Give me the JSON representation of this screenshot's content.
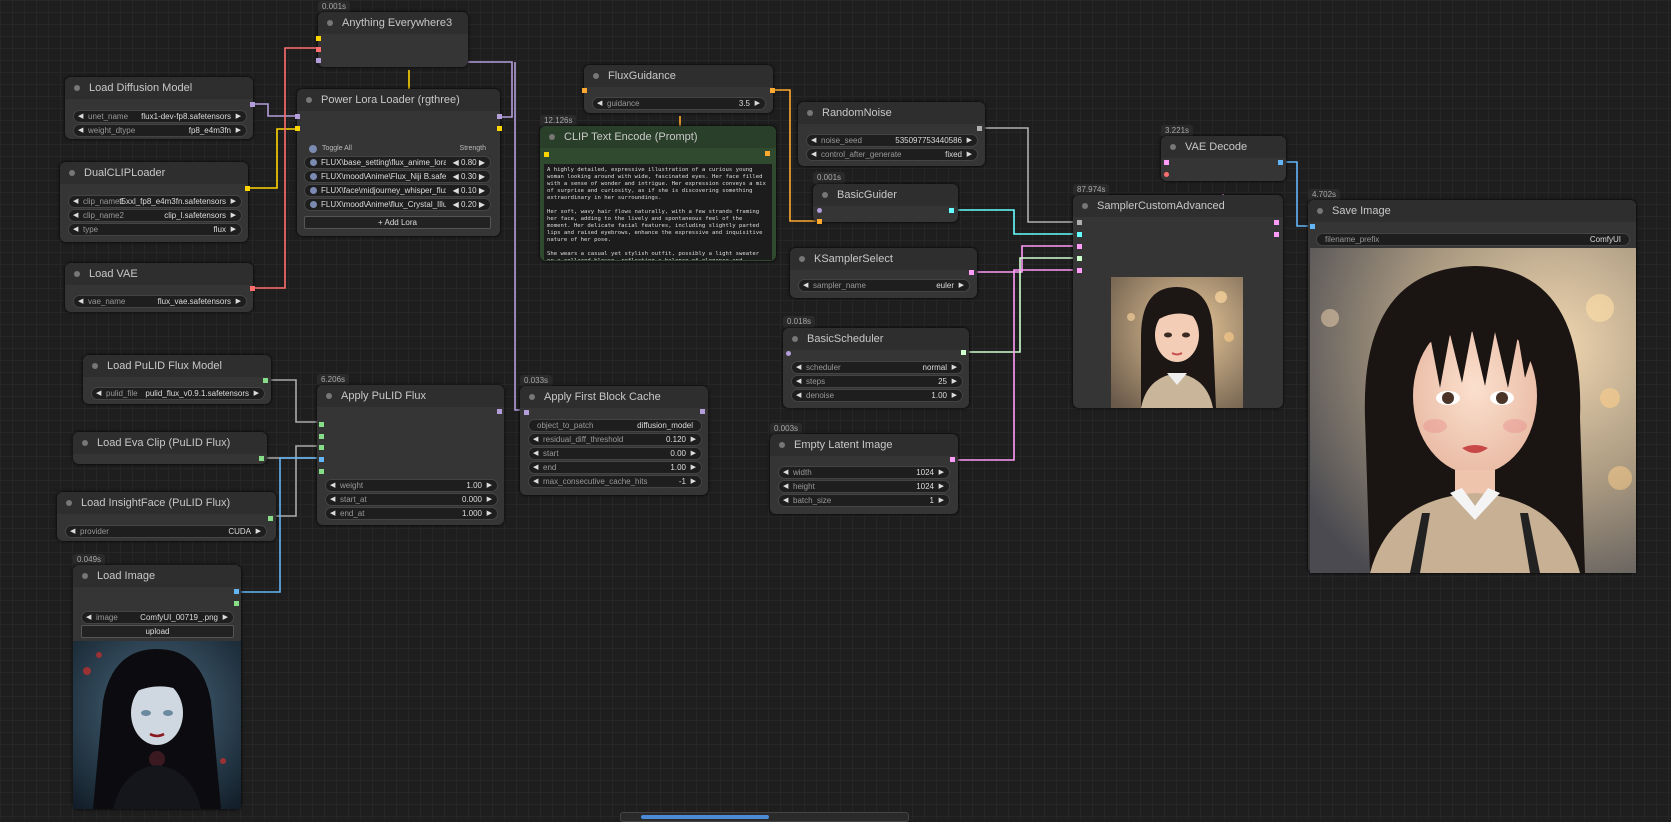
{
  "nodes": {
    "anything_everywhere": {
      "title": "Anything Everywhere3",
      "timing": "0.001s"
    },
    "load_diffusion": {
      "title": "Load Diffusion Model",
      "unet_name_label": "unet_name",
      "unet_name": "flux1-dev-fp8.safetensors",
      "weight_dtype_label": "weight_dtype",
      "weight_dtype": "fp8_e4m3fn"
    },
    "dual_clip": {
      "title": "DualCLIPLoader",
      "clip1_label": "clip_name1",
      "clip1": "t5xxl_fp8_e4m3fn.safetensors",
      "clip2_label": "clip_name2",
      "clip2": "clip_l.safetensors",
      "type_label": "type",
      "type": "flux"
    },
    "load_vae": {
      "title": "Load VAE",
      "vae_label": "vae_name",
      "vae": "flux_vae.safetensors"
    },
    "power_lora": {
      "title": "Power Lora Loader (rgthree)",
      "toggle_all": "Toggle All",
      "strength": "Strength",
      "loras": [
        {
          "name": "FLUX\\base_setting\\flux_anime_lora.sa...",
          "strength": "0.80"
        },
        {
          "name": "FLUX\\mood\\Anime\\Flux_Niji B.safeten...",
          "strength": "0.30"
        },
        {
          "name": "FLUX\\face\\midjourney_whisper_flux_lo...",
          "strength": "0.10"
        },
        {
          "name": "FLUX\\mood\\Anime\\flux_Crystal_Illustr...",
          "strength": "0.20"
        }
      ],
      "add_lora": "+ Add Lora"
    },
    "flux_guidance": {
      "title": "FluxGuidance",
      "guidance_label": "guidance",
      "guidance": "3.5"
    },
    "clip_text": {
      "title": "CLIP Text Encode (Prompt)",
      "timing": "12.126s",
      "prompt": [
        "A highly detailed, expressive illustration of a curious young woman looking around with wide, fascinated eyes. Her face filled with a sense of wonder and intrigue. Her expression conveys a mix of surprise and curiosity, as if she is discovering something extraordinary in her surroundings.",
        "Her soft, wavy hair flows naturally, with a few strands framing her face, adding to the lively and spontaneous feel of the moment. Her delicate facial features, including slightly parted lips and raised eyebrows, enhance the expressive and inquisitive nature of her pose.",
        "She wears a casual yet stylish outfit, possibly a light sweater or a collared blouse, reflecting a balance of elegance and everyday charm. The lighting is soft and warm, casting gentle highlights on her smooth skin"
      ]
    },
    "random_noise": {
      "title": "RandomNoise",
      "seed_label": "noise_seed",
      "seed": "535097753440586",
      "control_label": "control_after_generate",
      "control": "fixed"
    },
    "basic_guider": {
      "title": "BasicGuider",
      "timing": "0.001s"
    },
    "ksampler_select": {
      "title": "KSamplerSelect",
      "sampler_label": "sampler_name",
      "sampler": "euler"
    },
    "basic_scheduler": {
      "title": "BasicScheduler",
      "timing": "0.018s",
      "scheduler_label": "scheduler",
      "scheduler": "normal",
      "steps_label": "steps",
      "steps": "25",
      "denoise_label": "denoise",
      "denoise": "1.00"
    },
    "empty_latent": {
      "title": "Empty Latent Image",
      "timing": "0.003s",
      "width_label": "width",
      "width": "1024",
      "height_label": "height",
      "height": "1024",
      "batch_label": "batch_size",
      "batch": "1"
    },
    "vae_decode": {
      "title": "VAE Decode",
      "timing": "3.221s"
    },
    "sampler_custom": {
      "title": "SamplerCustomAdvanced",
      "timing": "87.974s"
    },
    "save_image": {
      "title": "Save Image",
      "timing": "4.702s",
      "prefix_label": "filename_prefix",
      "prefix": "ComfyUI"
    },
    "load_pulid": {
      "title": "Load PuLID Flux Model",
      "file_label": "pulid_file",
      "file": "pulid_flux_v0.9.1.safetensors"
    },
    "load_eva": {
      "title": "Load Eva Clip (PuLID Flux)"
    },
    "load_insight": {
      "title": "Load InsightFace (PuLID Flux)",
      "provider_label": "provider",
      "provider": "CUDA"
    },
    "apply_pulid": {
      "title": "Apply PuLID Flux",
      "timing": "6.206s",
      "weight_label": "weight",
      "weight": "1.00",
      "start_label": "start_at",
      "start": "0.000",
      "end_label": "end_at",
      "end": "1.000"
    },
    "first_block_cache": {
      "title": "Apply First Block Cache",
      "timing": "0.033s",
      "patch_label": "object_to_patch",
      "patch": "diffusion_model",
      "residual_label": "residual_diff_threshold",
      "residual": "0.120",
      "start_label": "start",
      "start": "0.00",
      "end_label": "end",
      "end": "1.00",
      "max_label": "max_consecutive_cache_hits",
      "max": "-1"
    },
    "load_image": {
      "title": "Load Image",
      "timing": "0.049s",
      "image_label": "image",
      "image": "ComfyUI_00719_.png",
      "upload": "upload"
    }
  },
  "colors": {
    "model": "#b39ddb",
    "clip": "#ffd500",
    "vae": "#ff6e6e",
    "conditioning": "#ffa931",
    "noise": "#b0b0b0",
    "guider": "#66ffff",
    "sampler": "#ff9cf9",
    "sigmas": "#cdffcd",
    "latent": "#ff9cf9",
    "image": "#64b5f6",
    "pulid": "#88dd88"
  }
}
